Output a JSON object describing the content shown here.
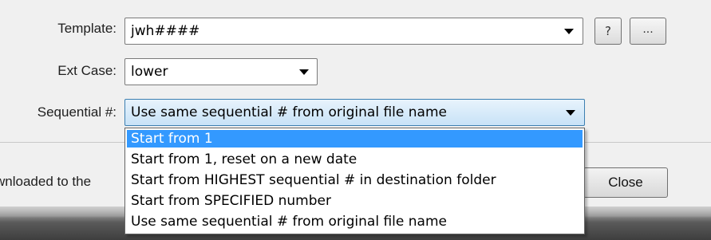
{
  "form": {
    "template_label": "Template:",
    "template_value": "jwh####",
    "help_label": "?",
    "browse_label": "...",
    "ext_case_label": "Ext Case:",
    "ext_case_value": "lower",
    "sequential_label": "Sequential #:",
    "sequential_value": "Use same sequential # from original file name"
  },
  "dropdown": {
    "options": [
      "Start from 1",
      "Start from 1, reset on a new date",
      "Start from HIGHEST sequential # in destination folder",
      "Start from SPECIFIED number",
      "Use same sequential # from original file name"
    ],
    "selected_index": 0
  },
  "footer": {
    "partial_text": "wnloaded to the",
    "close_label": "Close"
  },
  "colors": {
    "selection": "#3399ff",
    "combo_focus": "#c8e2f7"
  }
}
